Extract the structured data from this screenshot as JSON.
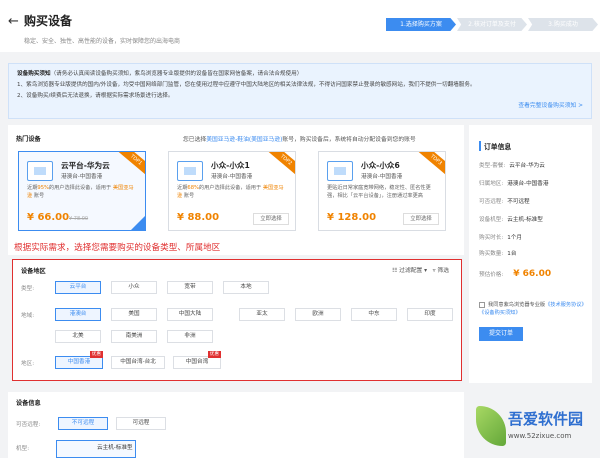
{
  "header": {
    "back_icon": "arrow-left-icon",
    "title": "购买设备",
    "subtitle": "稳定、安全、独性、高性能的设备，实时保障您的出海电商"
  },
  "steps": [
    "1.选择购买方案",
    "2.核对订单及支付",
    "3.购买成功"
  ],
  "notice": {
    "title": "设备购买须知",
    "intro": "（请务必认真阅读设备购买须知，紫鸟浏览器专业版提供的设备皆在国家网信备案，请合法合规使用）",
    "line1": "1、紫鸟浏览器专业版提供的国内/外设备，均受中国网络部门监管，您在使用过程中应遵守中国大陆地区的相关法律法规，不得访问国家禁止登录的敏感网站，我们不提供一切翻墙服务。",
    "line2": "2、设备购买/续费后无法退换，请根据实际需求场景进行选择。",
    "link": "查看完整设备购买须知 >"
  },
  "hot": {
    "title": "热门设备",
    "note_prefix": "您已选择",
    "note_link": "美国亚马逊-鞋油(美国亚马逊)",
    "note_suffix": "账号，购买设备后，系统将自动分配设备到您的账号"
  },
  "cards": [
    {
      "name": "云平台-华为云",
      "region": "港澳台-中国香港",
      "ribbon": "TOP1",
      "desc_a": "近期",
      "desc_hl": "95%",
      "desc_b": "的用户选择此设备，适用于 ",
      "desc_hl2": "美国亚马逊",
      "desc_c": " 账号",
      "price": "¥ 66.00",
      "old": "¥ 78.00",
      "btn": "立即选择"
    },
    {
      "name": "小众-小众1",
      "region": "港澳台-中国香港",
      "ribbon": "TOP2",
      "desc_a": "近期",
      "desc_hl": "68%",
      "desc_b": "的用户选择此设备，适用于 ",
      "desc_hl2": "美国亚马逊",
      "desc_c": " 账号",
      "price": "¥ 88.00",
      "old": "",
      "btn": "立即选择"
    },
    {
      "name": "小众-小众6",
      "region": "港澳台-中国香港",
      "ribbon": "TOP3",
      "desc_a": "更贴近日常家庭宽带网络，稳定性、匿名性更强，相比「云平台设备」，注册通过率更高",
      "desc_hl": "",
      "desc_b": "",
      "desc_hl2": "",
      "desc_c": "",
      "price": "¥ 128.00",
      "old": "",
      "btn": "立即选择"
    }
  ],
  "annotation": "根据实际需求，选择您需要购买的设备类型、所属地区",
  "location": {
    "title": "设备地区",
    "filter_label": "过滤配置",
    "filter_icon": "filter-icon",
    "filter_btn": "筛选",
    "type_label": "类型:",
    "types": [
      "云平台",
      "小众",
      "宽带",
      "本地"
    ],
    "region_label": "地域:",
    "regions_row1": [
      "港澳台",
      "美国",
      "中国大陆",
      "亚太",
      "欧洲",
      "中东",
      "印度"
    ],
    "regions_row2": [
      "北美",
      "南美洲",
      "非洲"
    ],
    "area_label": "地区:",
    "areas": [
      "中国香港",
      "中国台湾-台北",
      "中国台湾"
    ],
    "tag": "优惠"
  },
  "device_info": {
    "title": "设备信息",
    "remote_label": "可否远程:",
    "remote_options": [
      "不可远程",
      "可远程"
    ],
    "model_label": "机型:",
    "model_value": "云主机-标准型"
  },
  "order": {
    "title": "订单信息",
    "rows": [
      {
        "k": "类型-套餐:",
        "v": "云平台-华为云"
      },
      {
        "k": "归属地区:",
        "v": "港澳台-中国香港"
      },
      {
        "k": "可否远程:",
        "v": "不可远程"
      },
      {
        "k": "设备机型:",
        "v": "云主机-标准型"
      },
      {
        "k": "购买时长:",
        "v": "1个月"
      },
      {
        "k": "购买数量:",
        "v": "1台"
      }
    ],
    "price_label": "预估价格:",
    "price": "¥ 66.00",
    "agree_text": "我同意紫鸟浏览器专业版《技术服务协议》《设备购买须知》",
    "agree_prefix": "我同意紫鸟浏览器专业版",
    "agree_link": "《技术服务协议》《设备购买须知》",
    "submit": "提交订单"
  },
  "watermark": {
    "big": "吾爱软件园",
    "url": "www.52zixue.com"
  },
  "colors": {
    "accent": "#3c8cf0",
    "price": "#f08300",
    "annotation": "#e03030"
  }
}
